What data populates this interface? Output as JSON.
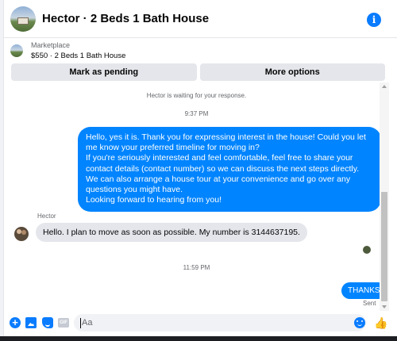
{
  "header": {
    "title": "Hector · 2 Beds 1 Bath House",
    "info_icon": "info-icon"
  },
  "listing": {
    "label": "Marketplace",
    "title": "$550 · 2 Beds 1 Bath House"
  },
  "actions": {
    "mark_pending": "Mark as pending",
    "more_options": "More options"
  },
  "conversation": {
    "system_text": "Hector is waiting for your response.",
    "timestamp_1": "9:37 PM",
    "outgoing_message": [
      "Hello, yes it is. Thank you for expressing interest in the house! Could you let me know your preferred timeline for moving in?",
      "If you're seriously interested and feel comfortable, feel free to share your contact details (contact number) so we can discuss the next steps directly. We can also arrange a house tour at your convenience and go over any questions you might have.",
      "Looking forward to hearing from you!"
    ],
    "sender_name": "Hector",
    "incoming_message": "Hello. I plan to move as soon as possible. My number is 3144637195.",
    "timestamp_2": "11:59 PM",
    "thanks_message": "THANKS",
    "sent_status": "Sent"
  },
  "composer": {
    "placeholder": "Aa",
    "value": ""
  },
  "colors": {
    "accent": "#0084ff",
    "icon_blue": "#0a7cff",
    "bubble_in": "#e4e6eb",
    "muted_text": "#65676b"
  }
}
